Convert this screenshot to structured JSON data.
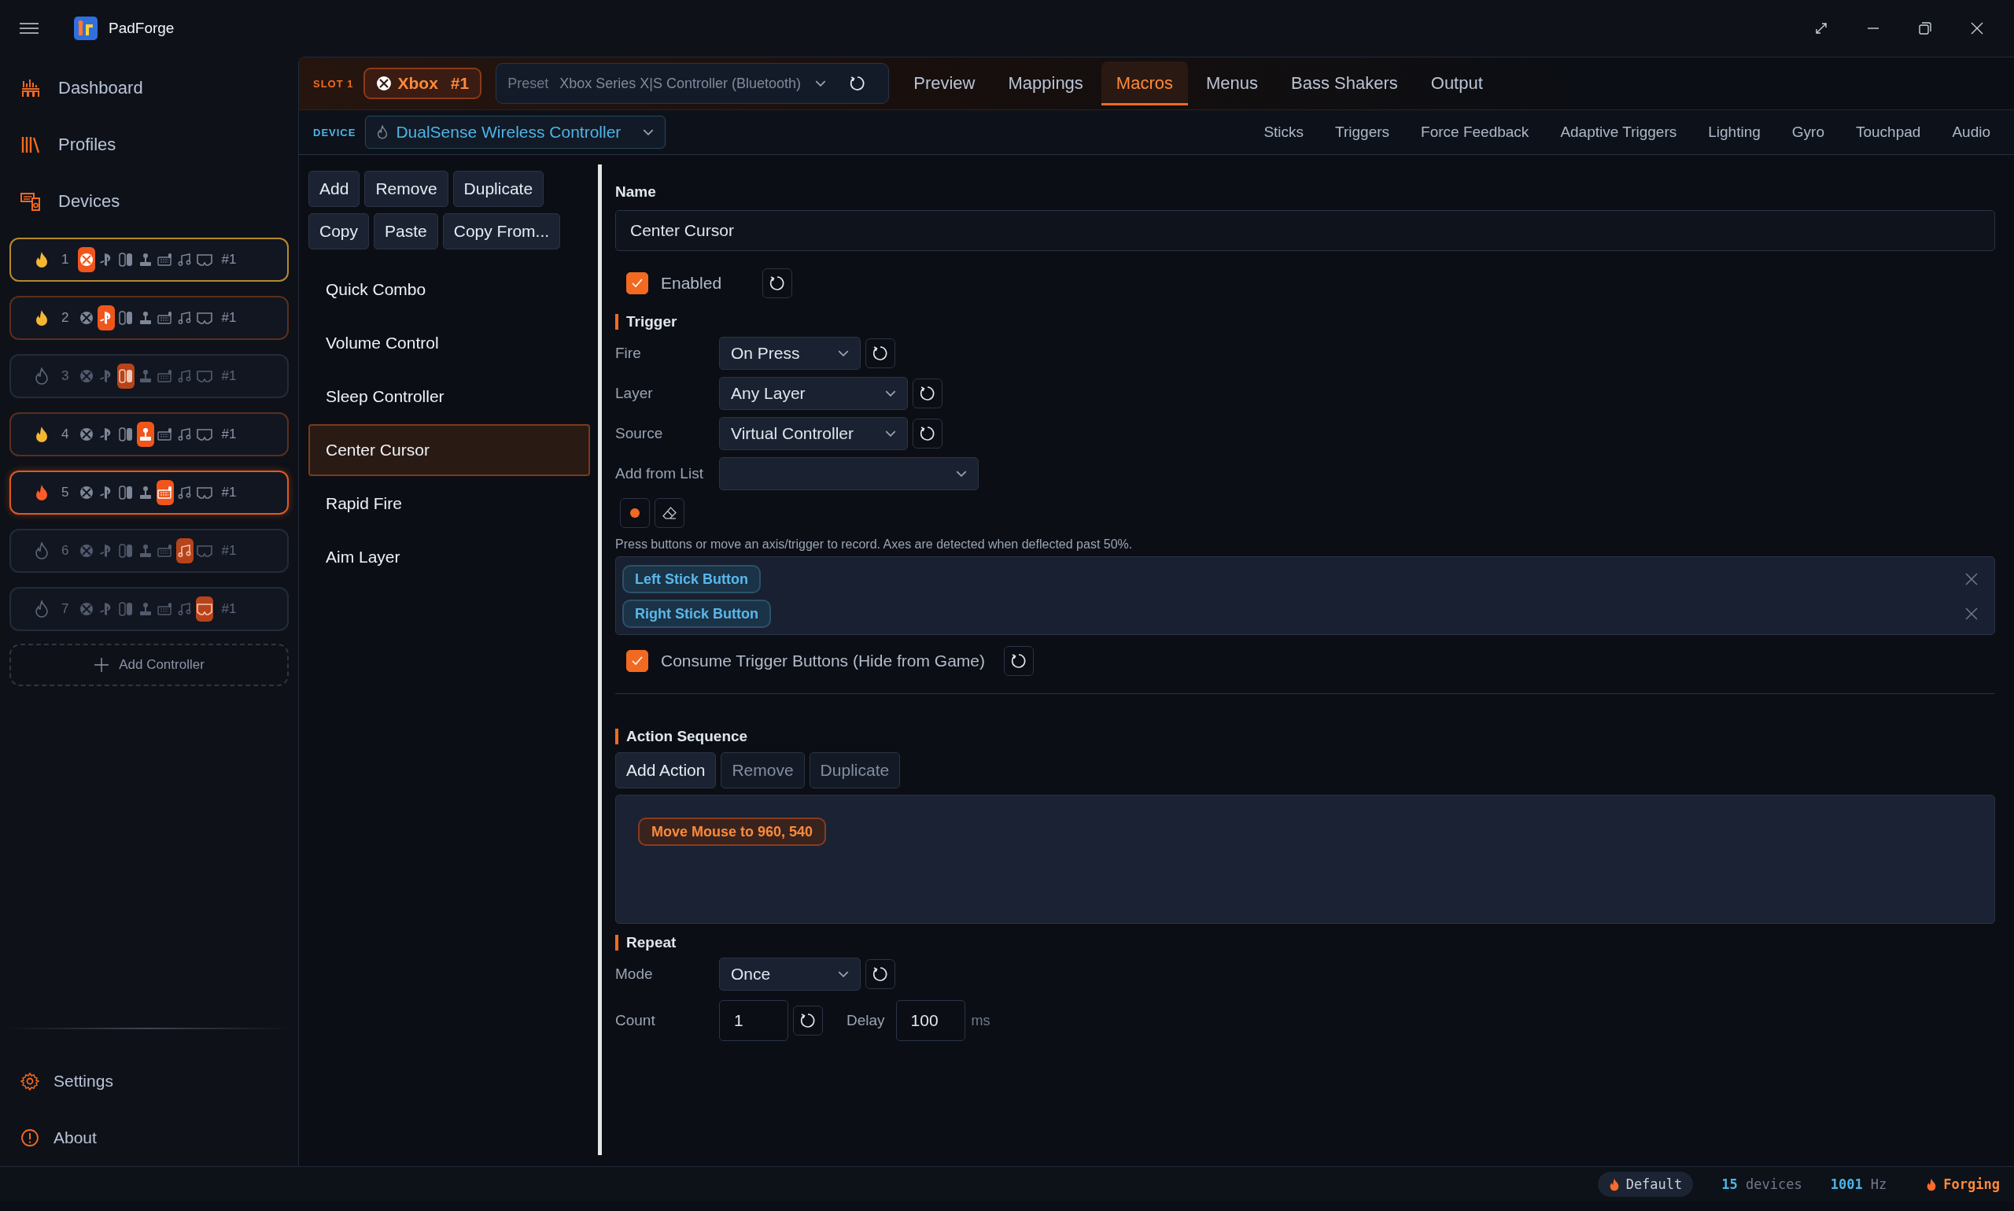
{
  "app": {
    "name": "PadForge"
  },
  "nav": [
    {
      "label": "Dashboard",
      "kind": "dashboard"
    },
    {
      "label": "Profiles",
      "kind": "profiles"
    },
    {
      "label": "Devices",
      "kind": "devices"
    }
  ],
  "slots": [
    {
      "number": "1",
      "connected": true,
      "active": false,
      "selected": true,
      "tag": "#1",
      "icons": [
        {
          "kind": "xbox",
          "selected": true
        },
        {
          "kind": "playstation",
          "selected": false
        },
        {
          "kind": "switch",
          "selected": false
        },
        {
          "kind": "joystick",
          "selected": false
        },
        {
          "kind": "keyboard",
          "selected": false
        },
        {
          "kind": "midi",
          "selected": false
        },
        {
          "kind": "vr",
          "selected": false
        }
      ]
    },
    {
      "number": "2",
      "connected": true,
      "active": false,
      "selected": false,
      "tag": "#1",
      "icons": [
        {
          "kind": "xbox",
          "selected": false
        },
        {
          "kind": "playstation",
          "selected": true
        },
        {
          "kind": "switch",
          "selected": false
        },
        {
          "kind": "joystick",
          "selected": false
        },
        {
          "kind": "keyboard",
          "selected": false
        },
        {
          "kind": "midi",
          "selected": false
        },
        {
          "kind": "vr",
          "selected": false
        }
      ]
    },
    {
      "number": "3",
      "connected": false,
      "active": false,
      "selected": false,
      "tag": "#1",
      "icons": [
        {
          "kind": "xbox",
          "selected": false
        },
        {
          "kind": "playstation",
          "selected": false
        },
        {
          "kind": "switch",
          "selected": true
        },
        {
          "kind": "joystick",
          "selected": false
        },
        {
          "kind": "keyboard",
          "selected": false
        },
        {
          "kind": "midi",
          "selected": false
        },
        {
          "kind": "vr",
          "selected": false
        }
      ]
    },
    {
      "number": "4",
      "connected": true,
      "active": false,
      "selected": false,
      "tag": "#1",
      "icons": [
        {
          "kind": "xbox",
          "selected": false
        },
        {
          "kind": "playstation",
          "selected": false
        },
        {
          "kind": "switch",
          "selected": false
        },
        {
          "kind": "joystick",
          "selected": true
        },
        {
          "kind": "keyboard",
          "selected": false
        },
        {
          "kind": "midi",
          "selected": false
        },
        {
          "kind": "vr",
          "selected": false
        }
      ]
    },
    {
      "number": "5",
      "connected": true,
      "active": true,
      "selected": false,
      "tag": "#1",
      "icons": [
        {
          "kind": "xbox",
          "selected": false
        },
        {
          "kind": "playstation",
          "selected": false
        },
        {
          "kind": "switch",
          "selected": false
        },
        {
          "kind": "joystick",
          "selected": false
        },
        {
          "kind": "keyboard",
          "selected": true
        },
        {
          "kind": "midi",
          "selected": false
        },
        {
          "kind": "vr",
          "selected": false
        }
      ]
    },
    {
      "number": "6",
      "connected": false,
      "active": false,
      "selected": false,
      "tag": "#1",
      "icons": [
        {
          "kind": "xbox",
          "selected": false
        },
        {
          "kind": "playstation",
          "selected": false
        },
        {
          "kind": "switch",
          "selected": false
        },
        {
          "kind": "joystick",
          "selected": false
        },
        {
          "kind": "keyboard",
          "selected": false
        },
        {
          "kind": "midi",
          "selected": true
        },
        {
          "kind": "vr",
          "selected": false
        }
      ]
    },
    {
      "number": "7",
      "connected": false,
      "active": false,
      "selected": false,
      "tag": "#1",
      "icons": [
        {
          "kind": "xbox",
          "selected": false
        },
        {
          "kind": "playstation",
          "selected": false
        },
        {
          "kind": "switch",
          "selected": false
        },
        {
          "kind": "joystick",
          "selected": false
        },
        {
          "kind": "keyboard",
          "selected": false
        },
        {
          "kind": "midi",
          "selected": false
        },
        {
          "kind": "vr",
          "selected": true
        }
      ]
    }
  ],
  "add_controller": "Add Controller",
  "footer_nav": [
    {
      "label": "Settings",
      "kind": "settings"
    },
    {
      "label": "About",
      "kind": "about"
    }
  ],
  "header": {
    "slot_label": "SLOT 1",
    "slot_chip": {
      "name": "Xbox",
      "number": "#1"
    },
    "preset": {
      "label": "Preset",
      "value": "Xbox Series X|S Controller (Bluetooth)"
    },
    "tabs": [
      {
        "label": "Preview",
        "selected": false
      },
      {
        "label": "Mappings",
        "selected": false
      },
      {
        "label": "Macros",
        "selected": true
      },
      {
        "label": "Menus",
        "selected": false
      },
      {
        "label": "Bass Shakers",
        "selected": false
      },
      {
        "label": "Output",
        "selected": false
      }
    ]
  },
  "device_bar": {
    "label": "DEVICE",
    "value": "DualSense Wireless Controller",
    "tabs": [
      {
        "label": "Sticks",
        "selected": false
      },
      {
        "label": "Triggers",
        "selected": false
      },
      {
        "label": "Force Feedback",
        "selected": false
      },
      {
        "label": "Adaptive Triggers",
        "selected": false
      },
      {
        "label": "Lighting",
        "selected": false
      },
      {
        "label": "Gyro",
        "selected": false
      },
      {
        "label": "Touchpad",
        "selected": false
      },
      {
        "label": "Audio",
        "selected": false
      }
    ]
  },
  "macro_toolbar": [
    [
      "Add",
      "Remove",
      "Duplicate"
    ],
    [
      "Copy",
      "Paste",
      "Copy From..."
    ]
  ],
  "macros": [
    {
      "name": "Quick Combo",
      "selected": false
    },
    {
      "name": "Volume Control",
      "selected": false
    },
    {
      "name": "Sleep Controller",
      "selected": false
    },
    {
      "name": "Center Cursor",
      "selected": true
    },
    {
      "name": "Rapid Fire",
      "selected": false
    },
    {
      "name": "Aim Layer",
      "selected": false
    }
  ],
  "editor": {
    "name_label": "Name",
    "name_value": "Center Cursor",
    "enabled": {
      "label": "Enabled",
      "checked": true
    },
    "trigger": {
      "title": "Trigger",
      "fields": [
        {
          "label": "Fire",
          "value": "On Press"
        },
        {
          "label": "Layer",
          "value": "Any Layer"
        },
        {
          "label": "Source",
          "value": "Virtual Controller"
        }
      ],
      "add_from_list": {
        "label": "Add from List"
      },
      "hint": "Press buttons or move an axis/trigger to record. Axes are detected when deflected past 50%.",
      "buttons": [
        {
          "label": "Left Stick Button"
        },
        {
          "label": "Right Stick Button"
        }
      ],
      "consume": {
        "label": "Consume Trigger Buttons (Hide from Game)",
        "checked": true
      }
    },
    "actions": {
      "title": "Action Sequence",
      "buttons": [
        {
          "label": "Add Action",
          "disabled": false
        },
        {
          "label": "Remove",
          "disabled": true
        },
        {
          "label": "Duplicate",
          "disabled": true
        }
      ],
      "items": [
        {
          "label": "Move Mouse to 960, 540"
        }
      ]
    },
    "repeat": {
      "title": "Repeat",
      "mode": {
        "label": "Mode",
        "value": "Once"
      },
      "count": {
        "label": "Count",
        "value": "1"
      },
      "delay": {
        "label": "Delay",
        "value": "100",
        "unit": "ms"
      }
    }
  },
  "status_bar": {
    "profile": "Default",
    "devices_count": "15",
    "devices_label": "devices",
    "rate_value": "1001",
    "rate_unit": "Hz",
    "state": "Forging"
  }
}
